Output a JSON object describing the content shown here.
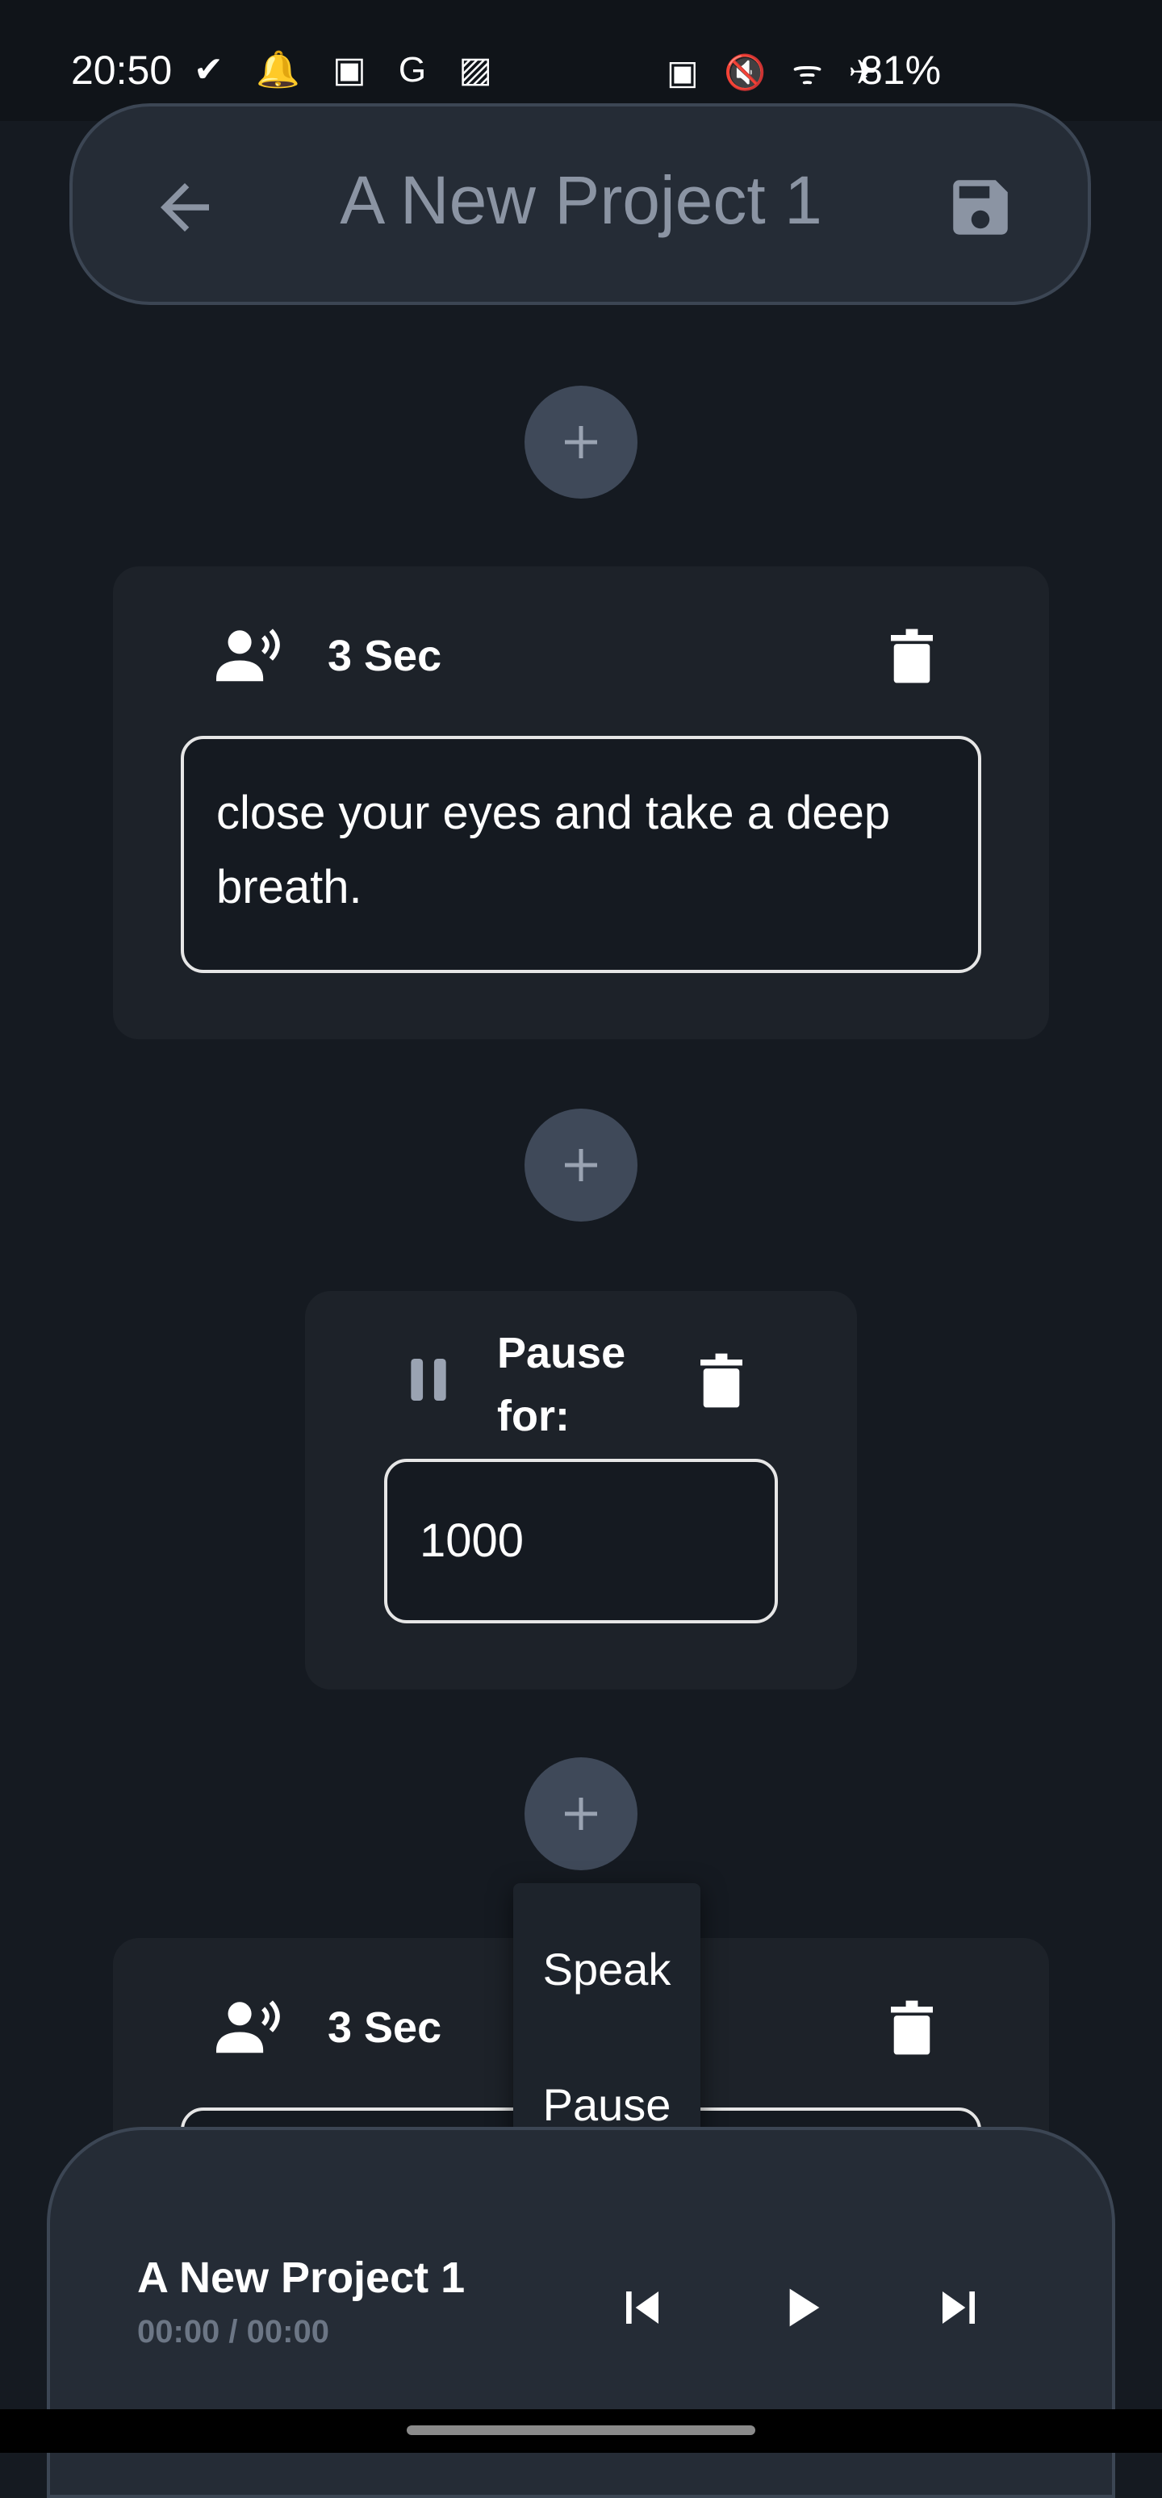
{
  "status_bar": {
    "time": "20:50",
    "left_icons": "✔ 🔔 ▣ G ▨",
    "right_icons": "▣ 🔇 ᯤ ✈",
    "battery": "81%"
  },
  "header": {
    "title": "A New Project 1",
    "back_icon": "arrow-left-icon",
    "save_icon": "floppy-disk-icon"
  },
  "blocks": [
    {
      "type": "speak",
      "duration": "3 Sec",
      "text": "close your eyes and take a deep breath."
    },
    {
      "type": "pause",
      "label": "Pause for:",
      "value": "1000"
    },
    {
      "type": "speak",
      "duration": "3 Sec",
      "text": ""
    }
  ],
  "add_menu": {
    "items": [
      "Speak",
      "Pause"
    ]
  },
  "player": {
    "title": "A New Project 1",
    "time": "00:00 / 00:00"
  },
  "colors": {
    "background": "#151a21",
    "card": "#1d2229",
    "accent_button": "#3f4959",
    "header_text": "#8b94a3"
  }
}
